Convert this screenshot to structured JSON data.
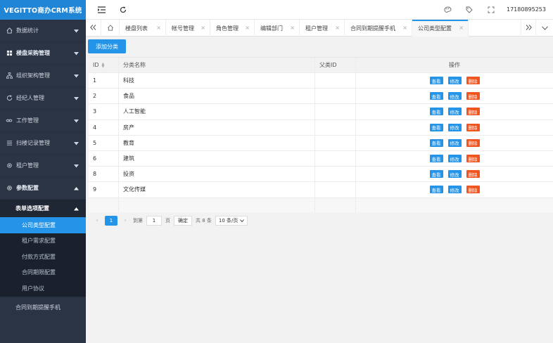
{
  "app": {
    "title": "VEGITTO商办CRM系统"
  },
  "sidebar": {
    "items": [
      {
        "label": "数据统计",
        "icon": "home-icon",
        "bold": false
      },
      {
        "label": "楼盘采购管理",
        "icon": "grid-icon",
        "bold": true
      },
      {
        "label": "组织架构管理",
        "icon": "sitemap-icon",
        "bold": false
      },
      {
        "label": "经纪人管理",
        "icon": "refresh-icon",
        "bold": false
      },
      {
        "label": "工作管理",
        "icon": "link-icon",
        "bold": false
      },
      {
        "label": "扫楼记录管理",
        "icon": "list-icon",
        "bold": false
      },
      {
        "label": "租户管理",
        "icon": "gear-icon",
        "bold": false
      },
      {
        "label": "参数配置",
        "icon": "gear-icon",
        "bold": true
      }
    ],
    "sub_parent": "表单选项配置",
    "sub_items": [
      "公司类型配置",
      "租户需求配置",
      "付款方式配置",
      "合同期限配置",
      "用户协议"
    ],
    "last_item": "合同到期提醒手机"
  },
  "topbar": {
    "user": "17180895253"
  },
  "tabs": [
    "楼盘列表",
    "帐号管理",
    "角色管理",
    "编辑部门",
    "租户管理",
    "合同到期提醒手机",
    "公司类型配置"
  ],
  "toolbar": {
    "add_label": "添加分类"
  },
  "table": {
    "headers": {
      "id": "ID",
      "name": "分类名称",
      "pid": "父类ID",
      "op": "操作"
    },
    "rows": [
      {
        "id": "1",
        "name": "科技",
        "pid": ""
      },
      {
        "id": "2",
        "name": "食品",
        "pid": ""
      },
      {
        "id": "3",
        "name": "人工智能",
        "pid": ""
      },
      {
        "id": "4",
        "name": "房产",
        "pid": ""
      },
      {
        "id": "5",
        "name": "教育",
        "pid": ""
      },
      {
        "id": "6",
        "name": "建筑",
        "pid": ""
      },
      {
        "id": "8",
        "name": "投资",
        "pid": ""
      },
      {
        "id": "9",
        "name": "文化传媒",
        "pid": ""
      }
    ],
    "actions": {
      "view": "查看",
      "edit": "修改",
      "delete": "删除"
    }
  },
  "pager": {
    "current": "1",
    "goto_label": "到第",
    "page_input": "1",
    "page_unit": "页",
    "confirm": "确定",
    "total": "共 8 条",
    "per_page": "10 条/页"
  },
  "colors": {
    "accent": "#2494e8",
    "danger": "#f0541f",
    "sidebar": "#2b3445"
  }
}
